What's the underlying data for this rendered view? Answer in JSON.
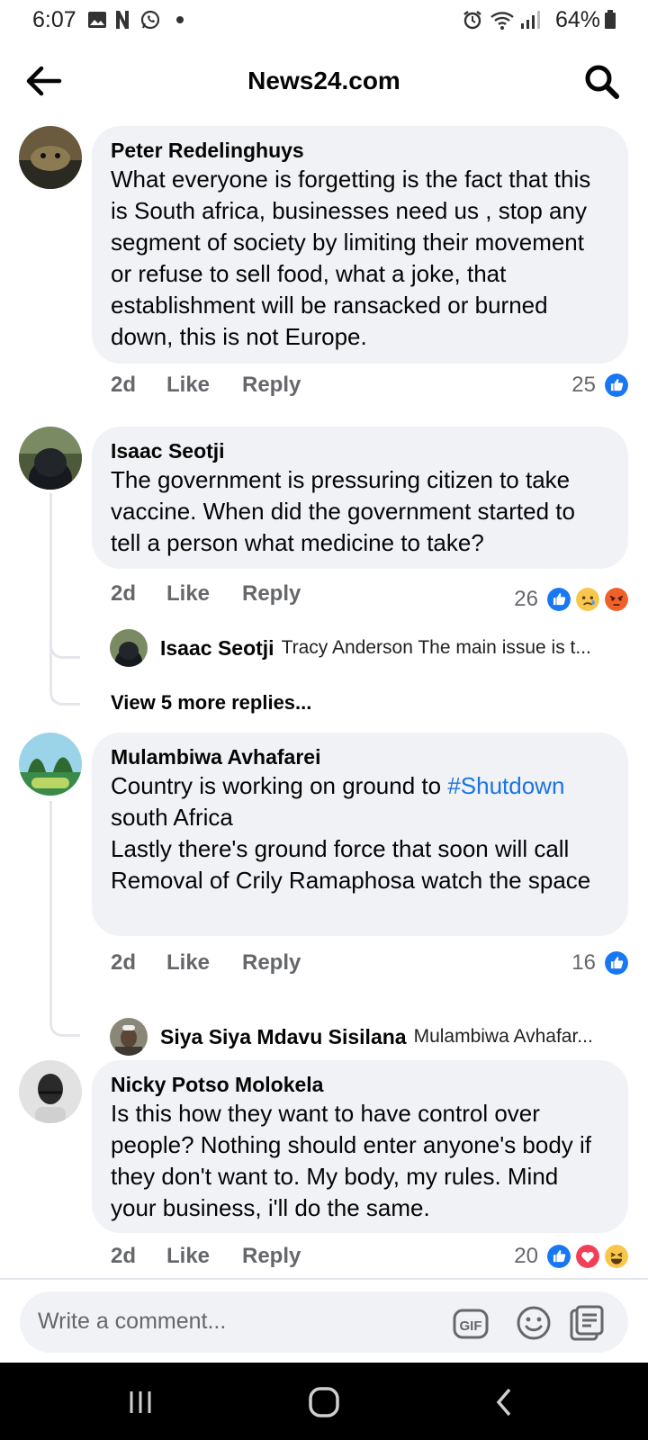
{
  "status_bar": {
    "time": "6:07",
    "battery": "64%"
  },
  "header": {
    "title": "News24.com"
  },
  "comments": [
    {
      "author": "Peter Redelinghuys",
      "text": "What everyone is forgetting is the fact that this is South africa,  businesses need us , stop any segment of society by limiting their movement or refuse to sell food, what a joke, that establishment will be ransacked or burned down, this is not Europe.",
      "time": "2d",
      "like": "Like",
      "reply": "Reply",
      "reaction_count": "25"
    },
    {
      "author": "Isaac Seotji",
      "text": "The government is pressuring citizen to take vaccine. When did the government started to tell a person what medicine to take?",
      "time": "2d",
      "like": "Like",
      "reply": "Reply",
      "reaction_count": "26",
      "reply_preview": {
        "author": "Isaac Seotji",
        "text": "Tracy Anderson The main issue is t..."
      },
      "view_more": "View 5 more replies..."
    },
    {
      "author": "Mulambiwa Avhafarei",
      "text_before": "Country is working on ground to ",
      "hashtag": "#Shutdown",
      "text_after": "\nsouth Africa\nLastly there's ground force that soon will call Removal of Crily Ramaphosa watch the space",
      "time": "2d",
      "like": "Like",
      "reply": "Reply",
      "reaction_count": "16",
      "reply_preview": {
        "author": "Siya Siya Mdavu Sisilana",
        "text": "Mulambiwa Avhafar..."
      }
    },
    {
      "author": "Nicky Potso Molokela",
      "text": "Is this how they want to have control over people? Nothing should enter anyone's body if they don't want to. My body, my rules. Mind your business, i'll do the same.",
      "time": "2d",
      "like": "Like",
      "reply": "Reply",
      "reaction_count": "20"
    }
  ],
  "composer": {
    "placeholder": "Write a comment..."
  },
  "colors": {
    "like_blue": "#1877f2",
    "bubble_gray": "#f0f2f5",
    "hashtag_blue": "#1b74e4",
    "angry_orange": "#f0602a",
    "sad_yellow": "#f7c64a",
    "love_red": "#f33e58"
  },
  "icons": [
    "image-icon",
    "netflix-icon",
    "whatsapp-icon",
    "alarm-icon",
    "wifi-icon",
    "signal-icon",
    "battery-icon",
    "back-arrow-icon",
    "search-icon",
    "like-reaction-icon",
    "sad-reaction-icon",
    "angry-reaction-icon",
    "love-reaction-icon",
    "haha-reaction-icon",
    "gif-icon",
    "emoji-icon",
    "sticker-icon",
    "recents-icon",
    "home-icon",
    "nav-back-icon"
  ]
}
